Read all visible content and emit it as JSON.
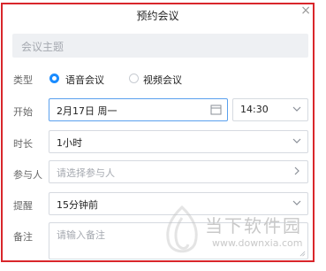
{
  "dialog": {
    "title": "预约会议",
    "close_glyph": "×",
    "subject_placeholder": "会议主题"
  },
  "type_row": {
    "label": "类型",
    "options": [
      {
        "label": "语音会议",
        "selected": true
      },
      {
        "label": "视频会议",
        "selected": false
      }
    ]
  },
  "start_row": {
    "label": "开始",
    "date": "2月17日 周一",
    "time": "14:30"
  },
  "duration_row": {
    "label": "时长",
    "value": "1小时"
  },
  "participants_row": {
    "label": "参与人",
    "placeholder": "请选择参与人"
  },
  "reminder_row": {
    "label": "提醒",
    "value": "15分钟前"
  },
  "notes_row": {
    "label": "备注",
    "placeholder": "请输入备注"
  },
  "watermark": {
    "title": "当下软件园",
    "url": "www.downxia.com"
  },
  "colors": {
    "accent": "#1a8cff",
    "border_highlight": "#d9262b",
    "input_bg": "#eef0f3"
  }
}
